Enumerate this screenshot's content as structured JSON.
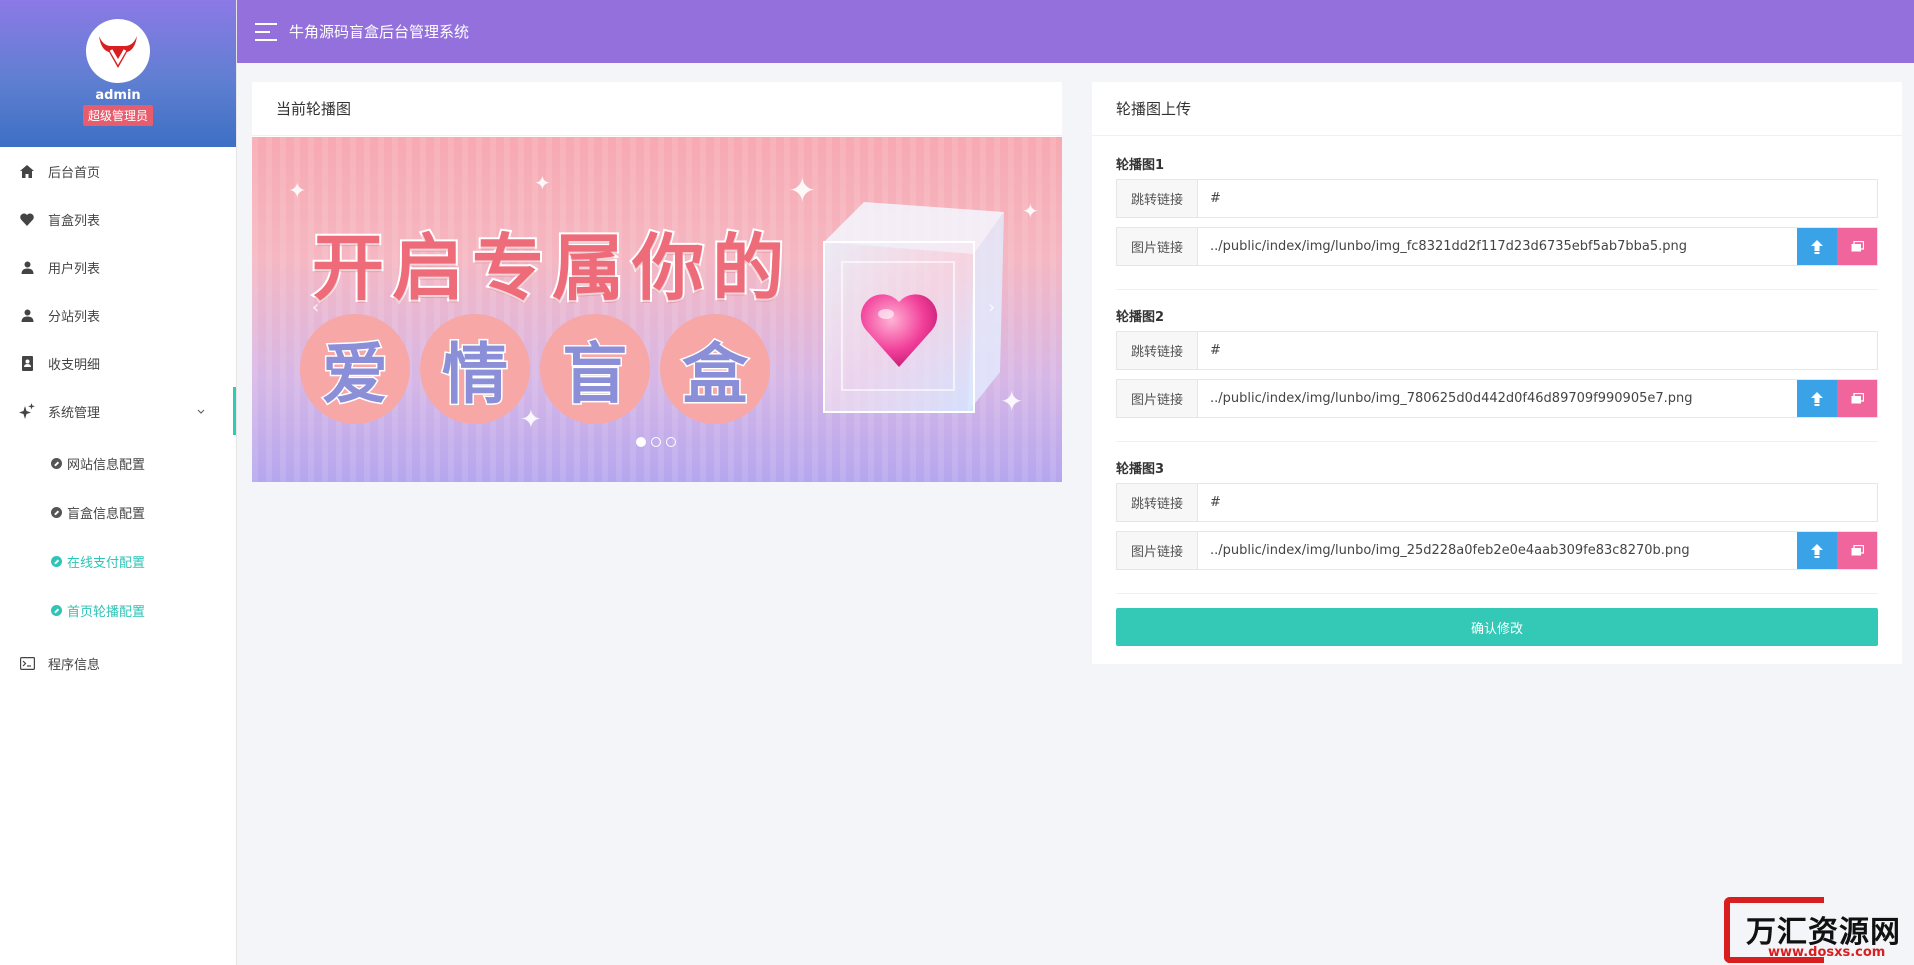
{
  "sidebar": {
    "username": "admin",
    "role": "超级管理员",
    "items": [
      {
        "label": "后台首页",
        "icon": "home-icon"
      },
      {
        "label": "盲盒列表",
        "icon": "heart-icon"
      },
      {
        "label": "用户列表",
        "icon": "user-icon"
      },
      {
        "label": "分站列表",
        "icon": "user-icon"
      },
      {
        "label": "收支明细",
        "icon": "ledger-icon"
      },
      {
        "label": "系统管理",
        "icon": "sparkle-icon"
      }
    ],
    "sub_items": [
      {
        "label": "网站信息配置"
      },
      {
        "label": "盲盒信息配置"
      },
      {
        "label": "在线支付配置"
      },
      {
        "label": "首页轮播配置"
      }
    ],
    "program_info": "程序信息"
  },
  "header": {
    "title": "牛角源码盲盒后台管理系统"
  },
  "left_panel": {
    "title": "当前轮播图",
    "banner": {
      "headline_chars": [
        "开",
        "启",
        "专",
        "属",
        "你",
        "的"
      ],
      "circle_chars": [
        "爱",
        "情",
        "盲",
        "盒"
      ],
      "prev": "‹",
      "next": "›"
    }
  },
  "right_panel": {
    "title": "轮播图上传",
    "groups": [
      {
        "title": "轮播图1",
        "link_label": "跳转链接",
        "link_value": "#",
        "image_label": "图片链接",
        "image_value": "../public/index/img/lunbo/img_fc8321dd2f117d23d6735ebf5ab7bba5.png"
      },
      {
        "title": "轮播图2",
        "link_label": "跳转链接",
        "link_value": "#",
        "image_label": "图片链接",
        "image_value": "../public/index/img/lunbo/img_780625d0d442d0f46d89709f990905e7.png"
      },
      {
        "title": "轮播图3",
        "link_label": "跳转链接",
        "link_value": "#",
        "image_label": "图片链接",
        "image_value": "../public/index/img/lunbo/img_25d228a0feb2e0e4aab309fe83c8270b.png"
      }
    ],
    "submit_label": "确认修改"
  },
  "watermark": {
    "text": "万汇资源网",
    "url": "www.dosxs.com"
  },
  "colors": {
    "header": "#9370db",
    "accent": "#33c9b6",
    "upload": "#3aa3e8",
    "gallery": "#f0659b",
    "badge": "#e85d6d"
  }
}
